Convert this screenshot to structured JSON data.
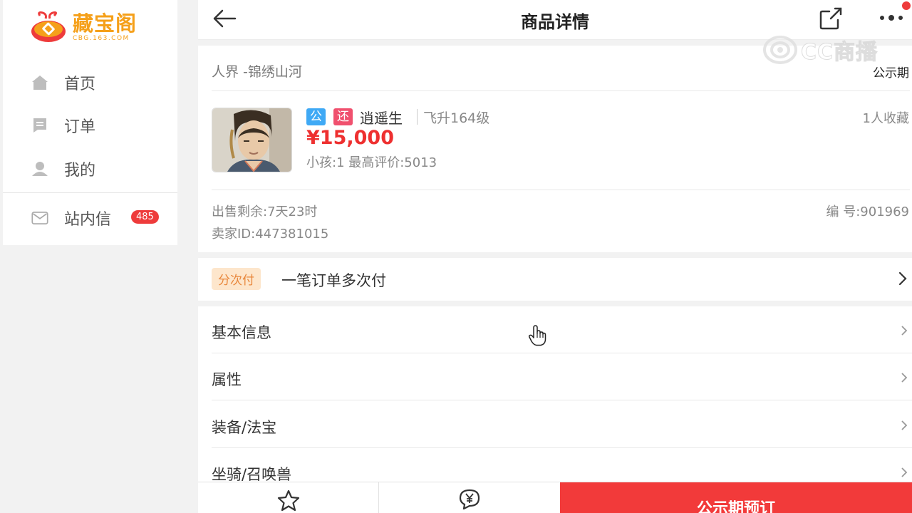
{
  "brand": {
    "logo_title": "藏宝阁",
    "logo_sub": "CBG.163.COM",
    "accent_color": "#f5a01a"
  },
  "sidebar": {
    "items": [
      {
        "label": "首页",
        "icon": "home-icon"
      },
      {
        "label": "订单",
        "icon": "order-icon"
      },
      {
        "label": "我的",
        "icon": "user-icon"
      },
      {
        "label": "站内信",
        "icon": "mail-icon",
        "badge": "485"
      }
    ]
  },
  "header": {
    "title": "商品详情",
    "back_icon": "back-arrow-icon",
    "share_icon": "share-icon",
    "more_icon": "more-icon"
  },
  "product": {
    "server": "人界 -锦绣山河",
    "status": "公示期",
    "tag_public": "公",
    "tag_bargain": "还",
    "name": "逍遥生",
    "level": "飞升164级",
    "favorites": "1人收藏",
    "price": "¥15,000",
    "sub_info": "小孩:1 最高评价:5013",
    "sale_remaining": "出售剩余:7天23时",
    "seller_id": "卖家ID:447381015",
    "item_no": "编 号:901969",
    "price_color": "#ee3030"
  },
  "installment": {
    "tag": "分次付",
    "label": "一笔订单多次付"
  },
  "sections": [
    {
      "label": "基本信息"
    },
    {
      "label": "属性"
    },
    {
      "label": "装备/法宝"
    },
    {
      "label": "坐骑/召唤兽"
    }
  ],
  "bottom_bar": {
    "favorite_icon": "star-icon",
    "bargain_icon": "yuan-bubble-icon",
    "reserve_label": "公示期预订",
    "reserve_color": "#f23a3a"
  },
  "watermark": {
    "text": "CC商播"
  }
}
